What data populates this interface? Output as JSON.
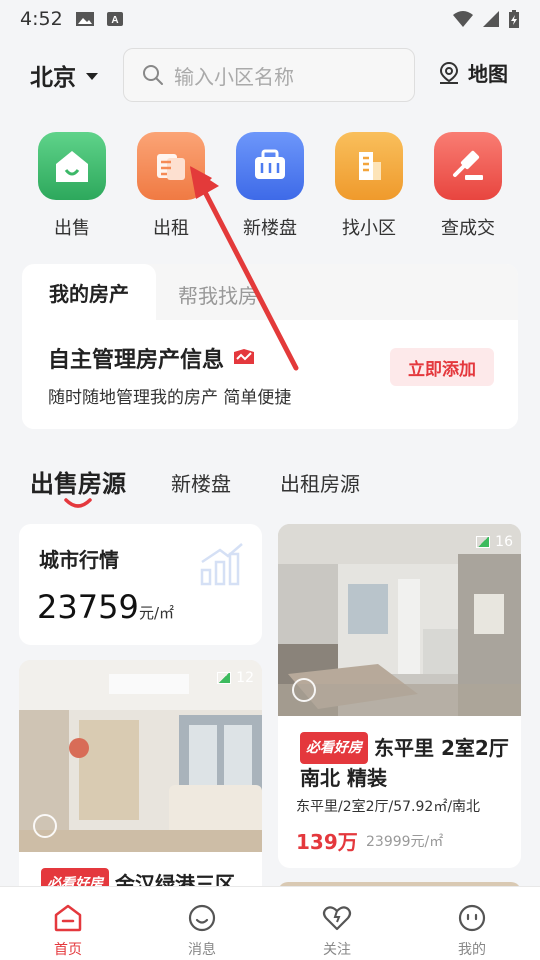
{
  "status_bar": {
    "time": "4:52"
  },
  "header": {
    "city": "北京",
    "search_placeholder": "输入小区名称",
    "map_label": "地图"
  },
  "quick_actions": [
    {
      "label": "出售",
      "icon": "house-icon",
      "color": "#3cb868"
    },
    {
      "label": "出租",
      "icon": "document-icon",
      "color": "#f58a55"
    },
    {
      "label": "新楼盘",
      "icon": "building-icon",
      "color": "#4d7cf0"
    },
    {
      "label": "找小区",
      "icon": "tower-icon",
      "color": "#f3a53c"
    },
    {
      "label": "查成交",
      "icon": "gavel-icon",
      "color": "#ee5955"
    }
  ],
  "property_panel": {
    "tab_active": "我的房产",
    "tab_other": "帮我找房",
    "title": "自主管理房产信息",
    "subtitle": "随时随地管理我的房产 简单便捷",
    "add_button": "立即添加"
  },
  "category_tabs": [
    "出售房源",
    "新楼盘",
    "出租房源"
  ],
  "market": {
    "title": "城市行情",
    "value": "23759",
    "unit": "元/㎡"
  },
  "listings": [
    {
      "photo_count": "16",
      "tag": "必看好房",
      "title": "东平里 2室2厅 南北 精装",
      "desc": "东平里/2室2厅/57.92㎡/南北",
      "price": "139万",
      "unit_price": "23999元/㎡"
    },
    {
      "photo_count": "12",
      "tag": "必看好房",
      "title": "金汉绿港三区"
    }
  ],
  "bottom_nav": [
    {
      "label": "首页",
      "icon": "home-icon",
      "active": true
    },
    {
      "label": "消息",
      "icon": "message-icon",
      "active": false
    },
    {
      "label": "关注",
      "icon": "heart-icon",
      "active": false
    },
    {
      "label": "我的",
      "icon": "profile-icon",
      "active": false
    }
  ],
  "colors": {
    "accent": "#e4383d",
    "background": "#f4f5f7"
  }
}
